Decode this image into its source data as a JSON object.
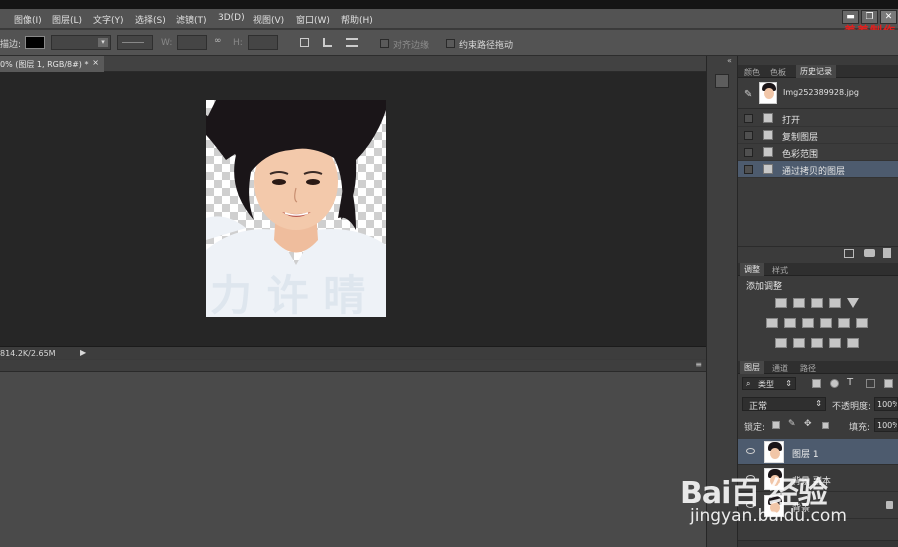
{
  "menu": [
    "图像(I)",
    "图层(L)",
    "文字(Y)",
    "选择(S)",
    "滤镜(T)",
    "3D(D)",
    "视图(V)",
    "窗口(W)",
    "帮助(H)"
  ],
  "watermark_title": "羞羞制作",
  "watermark_num": "00",
  "window": {
    "minimize": "▬",
    "restore": "❐",
    "close": "✕"
  },
  "options": {
    "stroke_label": "描边:",
    "w_label": "W:",
    "h_label": "H:",
    "align_edges": "对齐边缘",
    "constrain_path": "约束路径拖动"
  },
  "doc_tab": "0% (图层 1, RGB/8#) *",
  "doc_tab_close": "×",
  "status_text": "814.2K/2.65M",
  "photo_text": "力 许 晴",
  "history": {
    "tabs": [
      "颜色",
      "色板",
      "历史记录"
    ],
    "snapshot": "Img252389928.jpg",
    "items": [
      "打开",
      "复制图层",
      "色彩范围",
      "通过拷贝的图层"
    ]
  },
  "adjust": {
    "tabs": [
      "调整",
      "样式"
    ],
    "title": "添加调整"
  },
  "layers": {
    "tabs": [
      "图层",
      "通道",
      "路径"
    ],
    "filter_kind": "类型",
    "blend_mode": "正常",
    "opacity_label": "不透明度:",
    "opacity_value": "100%",
    "lock_label": "锁定:",
    "fill_label": "填充:",
    "fill_value": "100%",
    "items": [
      {
        "name": "图层 1"
      },
      {
        "name": "背景 副本"
      },
      {
        "name": "背景"
      }
    ]
  },
  "baidu": {
    "brand": "Bai百 经验",
    "url": "jingyan.baidu.com"
  },
  "colors": {
    "accent": "#e0201e",
    "selected_row": "#4d5b6e",
    "canvas": "#262626"
  }
}
